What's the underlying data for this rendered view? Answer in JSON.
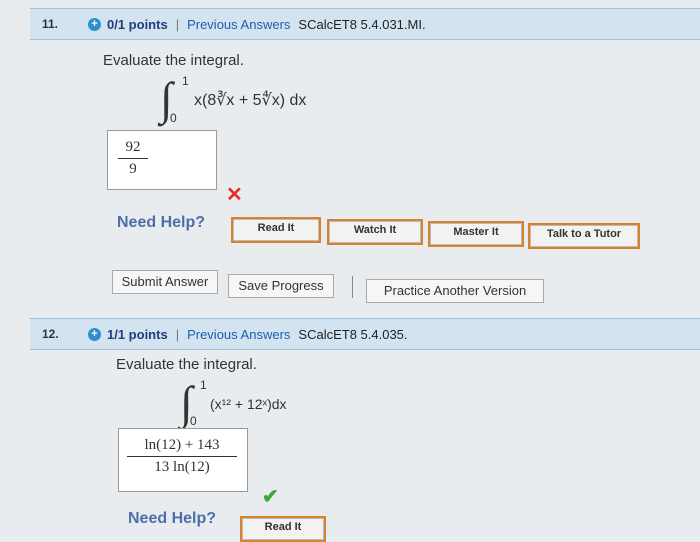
{
  "q11": {
    "number": "11.",
    "points": "0/1 points",
    "separator": "|",
    "previous_answers": "Previous Answers",
    "source": "SCalcET8 5.4.031.MI.",
    "prompt": "Evaluate the integral.",
    "upper_limit": "1",
    "lower_limit": "0",
    "integrand": "x(8∛x + 5∜x) dx",
    "answer_numerator": "92",
    "answer_denominator": "9",
    "result_icon": "x-icon",
    "need_help": "Need Help?",
    "help_buttons": [
      "Read It",
      "Watch It",
      "Master It",
      "Talk to a Tutor"
    ],
    "actions": {
      "submit": "Submit Answer",
      "save": "Save Progress",
      "practice": "Practice Another Version"
    }
  },
  "q12": {
    "number": "12.",
    "points": "1/1 points",
    "separator": "|",
    "previous_answers": "Previous Answers",
    "source": "SCalcET8 5.4.035.",
    "prompt": "Evaluate the integral.",
    "upper_limit": "1",
    "lower_limit": "0",
    "integrand": "(x¹² + 12ˣ)dx",
    "answer_numerator": "ln(12) + 143",
    "answer_denominator": "13 ln(12)",
    "result_icon": "check-icon",
    "need_help": "Need Help?",
    "help_buttons": [
      "Read It"
    ]
  },
  "colors": {
    "header_bg": "#d3e4f0",
    "link": "#1a5fb4",
    "wrong": "#e0302a",
    "correct": "#3ea93a",
    "help_border": "#d9822b"
  }
}
